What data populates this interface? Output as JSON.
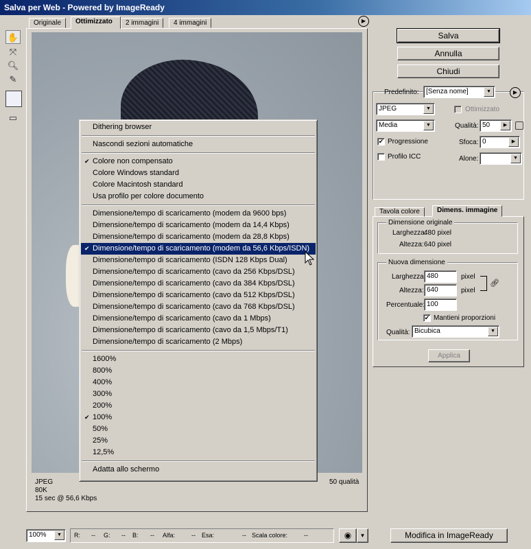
{
  "window": {
    "title": "Salva per Web - Powered by ImageReady"
  },
  "tabs": [
    "Originale",
    "Ottimizzato",
    "2 immagini",
    "4 immagini"
  ],
  "buttons": {
    "save": "Salva",
    "cancel": "Annulla",
    "close": "Chiudi",
    "apply": "Applica",
    "edit_in_imageready": "Modifica in ImageReady"
  },
  "settings": {
    "preset_label": "Predefinito:",
    "preset_value": "[Senza nome]",
    "format": "JPEG",
    "quality_level": "Media",
    "optimized_label": "Ottimizzato",
    "quality_label": "Qualità:",
    "quality_value": "50",
    "progressive_label": "Progressione",
    "blur_label": "Sfoca:",
    "blur_value": "0",
    "icc_label": "Profilo ICC",
    "matte_label": "Alone:",
    "matte_value": ""
  },
  "size_panel": {
    "tab_color_table": "Tavola colore",
    "tab_image_size": "Dimens. immagine",
    "original_title": "Dimensione originale",
    "orig_width_label": "Larghezza:",
    "orig_width": "480 pixel",
    "orig_height_label": "Altezza:",
    "orig_height": "640 pixel",
    "new_title": "Nuova dimensione",
    "width_label": "Larghezza:",
    "width_value": "480",
    "height_label": "Altezza:",
    "height_value": "640",
    "unit": "pixel",
    "percent_label": "Percentuale:",
    "percent_value": "100",
    "constrain_label": "Mantieni proporzioni",
    "quality_label": "Qualità:",
    "quality_value": "Bicubica"
  },
  "image_info": {
    "format": "JPEG",
    "size": "80K",
    "time": "15 sec @ 56,6 Kbps",
    "quality": "50 qualità"
  },
  "menu": [
    {
      "label": "Dithering browser"
    },
    {
      "sep": true
    },
    {
      "label": "Nascondi sezioni automatiche"
    },
    {
      "sep": true
    },
    {
      "label": "Colore non compensato",
      "checked": true
    },
    {
      "label": "Colore Windows standard"
    },
    {
      "label": "Colore Macintosh standard"
    },
    {
      "label": "Usa profilo per colore documento"
    },
    {
      "sep": true
    },
    {
      "label": "Dimensione/tempo di scaricamento (modem da 9600 bps)"
    },
    {
      "label": "Dimensione/tempo di scaricamento (modem da 14,4 Kbps)"
    },
    {
      "label": "Dimensione/tempo di scaricamento (modem da 28,8 Kbps)"
    },
    {
      "label": "Dimensione/tempo di scaricamento (modem da 56,6 Kbps/ISDN)",
      "checked": true,
      "highlighted": true
    },
    {
      "label": "Dimensione/tempo di scaricamento (ISDN 128 Kbps Dual)"
    },
    {
      "label": "Dimensione/tempo di scaricamento (cavo da 256 Kbps/DSL)"
    },
    {
      "label": "Dimensione/tempo di scaricamento (cavo da 384 Kbps/DSL)"
    },
    {
      "label": "Dimensione/tempo di scaricamento (cavo da 512 Kbps/DSL)"
    },
    {
      "label": "Dimensione/tempo di scaricamento (cavo da 768 Kbps/DSL)"
    },
    {
      "label": "Dimensione/tempo di scaricamento (cavo da 1 Mbps)"
    },
    {
      "label": "Dimensione/tempo di scaricamento (cavo da 1,5 Mbps/T1)"
    },
    {
      "label": "Dimensione/tempo di scaricamento (2 Mbps)"
    },
    {
      "sep": true
    },
    {
      "label": "1600%"
    },
    {
      "label": "800%"
    },
    {
      "label": "400%"
    },
    {
      "label": "300%"
    },
    {
      "label": "200%"
    },
    {
      "label": "100%",
      "checked": true
    },
    {
      "label": "50%"
    },
    {
      "label": "25%"
    },
    {
      "label": "12,5%"
    },
    {
      "sep": true
    },
    {
      "label": "Adatta allo schermo"
    }
  ],
  "status": {
    "zoom": "100%",
    "r_label": "R:",
    "r": "--",
    "g_label": "G:",
    "g": "--",
    "b_label": "B:",
    "b": "--",
    "alpha_label": "Alfa:",
    "alpha": "--",
    "hex_label": "Esa:",
    "hex": "--",
    "color_index_label": "Scala colore:",
    "color_index": "--"
  },
  "colors": {
    "highlight": "#0a246a",
    "face": "#d4d0c8"
  }
}
